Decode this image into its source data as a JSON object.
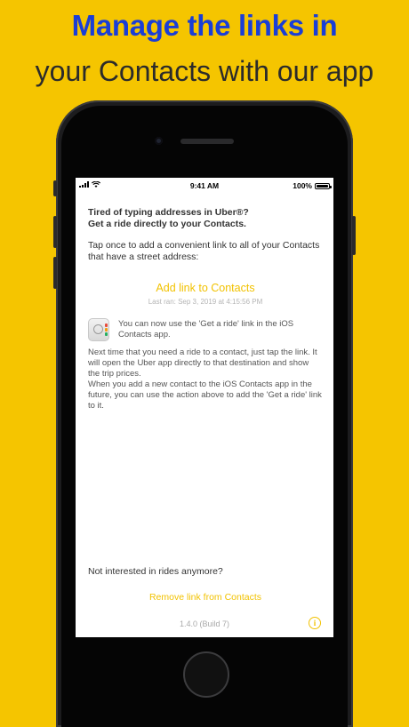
{
  "promo": {
    "headline_line1": "Manage the links in",
    "headline_line2": "your Contacts with our app"
  },
  "status_bar": {
    "time": "9:41 AM",
    "battery": "100%"
  },
  "intro": {
    "title_line1": "Tired of typing addresses in Uber®?",
    "title_line2": "Get a ride directly to your Contacts.",
    "body": "Tap once to add a convenient link to all of your Contacts that have a street address:"
  },
  "actions": {
    "add_label": "Add link to Contacts",
    "last_ran": "Last ran: Sep 3, 2019 at 4:15:56 PM",
    "remove_label": "Remove link from Contacts"
  },
  "note": {
    "icon": "contacts-app-icon",
    "text": "You can now use the 'Get a ride' link in the iOS Contacts app.",
    "detail_1": "Next time that you need a ride to a contact, just tap the link. It will open the Uber app directly to that destination and show the trip prices.",
    "detail_2": "When you add a new contact to the iOS Contacts app in the future, you can use the action above to add the 'Get a ride' link to it."
  },
  "footer": {
    "not_interested": "Not interested in rides anymore?",
    "version": "1.4.0 (Build 7)",
    "info_icon": "info-icon"
  },
  "colors": {
    "background": "#f5c500",
    "headline_blue": "#1a3ed6",
    "accent": "#f2c200"
  }
}
